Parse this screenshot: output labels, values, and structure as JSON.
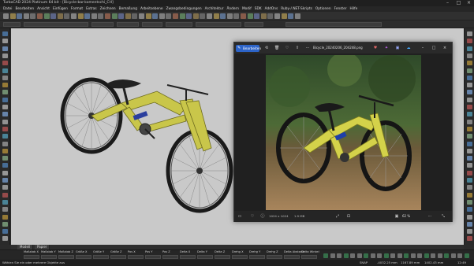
{
  "window": {
    "title": "TurboCAD 2024 Platinum 64 bit - [Bicycle-bar-komentschi_CH]"
  },
  "menu": [
    "Datei",
    "Bearbeiten",
    "Ansicht",
    "Einfügen",
    "Format",
    "Extras",
    "Zeichnen",
    "Bemaßung",
    "Arbeitsebene",
    "Zwangsbedingungen",
    "Architektur",
    "Ändern",
    "Modif",
    "SDK",
    "AddOns",
    "Ruby-/.NET-Skripts",
    "Optionen",
    "Fenster",
    "Hilfe"
  ],
  "view_tabs": [
    "Modell",
    "Papier"
  ],
  "coords": {
    "labels": [
      "Maßstab X",
      "Maßstab Y",
      "Maßstab Z",
      "Größe X",
      "Größe Y",
      "Größe Z",
      "Pos X",
      "Pos Y",
      "Pos Z",
      "Delta X",
      "Delta Y",
      "Delta Z",
      "Drehg X",
      "Drehg Y",
      "Drehg Z",
      "Delta Abstand",
      "Delta Winkel"
    ]
  },
  "status": {
    "hint": "Wählen Sie ein oder mehrere Objekte aus",
    "v1": "SNAP",
    "v2": "-4032.25 mm",
    "v3": "1167.89 mm",
    "v4": "1402.43 mm",
    "time": "12:49"
  },
  "photos": {
    "edit_label": "Bearbeiten",
    "filename": "Bicycle_20240206_204248.png",
    "info_resolution": "1024 x 1024",
    "info_size": "1.9 MB",
    "zoom": "62 %"
  },
  "colors": {
    "edit_accent": "#2d64c8",
    "bike_yellow": "#c9c64a",
    "viewport_bg": "#c9c9c9"
  }
}
